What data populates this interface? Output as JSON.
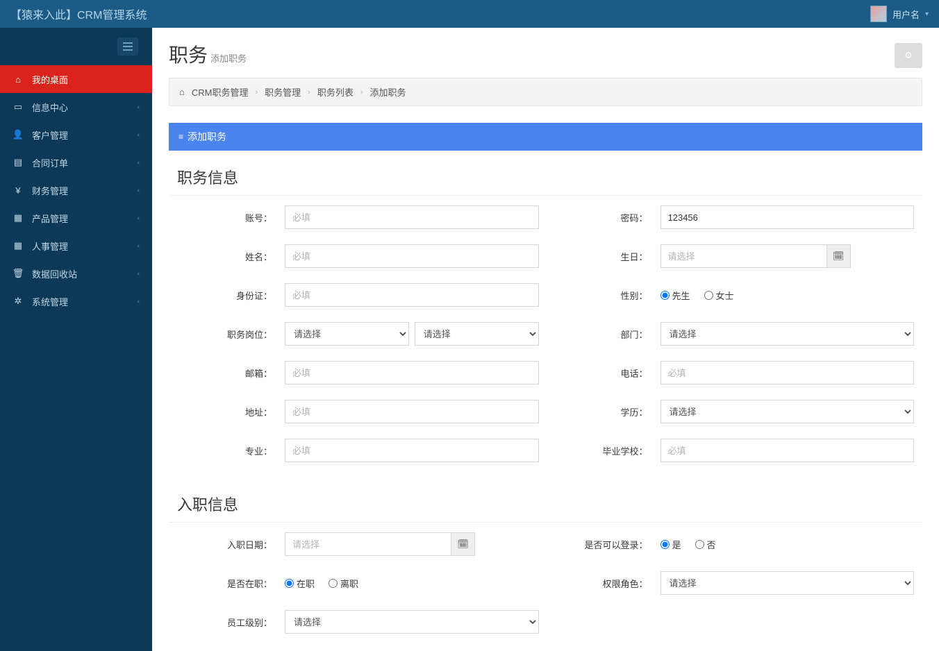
{
  "header": {
    "brand": "【猿来入此】CRM管理系统",
    "username": "用户名"
  },
  "sidebar": {
    "items": [
      {
        "icon": "home",
        "label": "我的桌面",
        "active": true,
        "expandable": false
      },
      {
        "icon": "credit",
        "label": "信息中心",
        "expandable": true
      },
      {
        "icon": "person",
        "label": "客户管理",
        "expandable": true
      },
      {
        "icon": "book",
        "label": "合同订单",
        "expandable": true
      },
      {
        "icon": "yen",
        "label": "财务管理",
        "expandable": true
      },
      {
        "icon": "grid",
        "label": "产品管理",
        "expandable": true
      },
      {
        "icon": "grid",
        "label": "人事管理",
        "expandable": true
      },
      {
        "icon": "trash",
        "label": "数据回收站",
        "expandable": true
      },
      {
        "icon": "cog",
        "label": "系统管理",
        "expandable": true
      }
    ]
  },
  "page": {
    "title": "职务",
    "subtitle": "添加职务"
  },
  "breadcrumb": {
    "items": [
      "CRM职务管理",
      "职务管理",
      "职务列表",
      "添加职务"
    ]
  },
  "panel": {
    "title": "添加职务"
  },
  "sections": {
    "s1_title": "职务信息",
    "s2_title": "入职信息"
  },
  "form": {
    "account": {
      "label": "账号：",
      "placeholder": "必填",
      "value": ""
    },
    "password": {
      "label": "密码：",
      "value": "123456"
    },
    "name": {
      "label": "姓名：",
      "placeholder": "必填",
      "value": ""
    },
    "birthday": {
      "label": "生日：",
      "placeholder": "请选择",
      "value": ""
    },
    "idcard": {
      "label": "身份证：",
      "placeholder": "必填",
      "value": ""
    },
    "gender": {
      "label": "性别：",
      "options": [
        "先生",
        "女士"
      ],
      "selected": "先生"
    },
    "position": {
      "label": "职务岗位：",
      "select1": "请选择",
      "select2": "请选择"
    },
    "department": {
      "label": "部门：",
      "select": "请选择"
    },
    "email": {
      "label": "邮箱：",
      "placeholder": "必填",
      "value": ""
    },
    "phone": {
      "label": "电话：",
      "placeholder": "必填",
      "value": ""
    },
    "address": {
      "label": "地址：",
      "placeholder": "必填",
      "value": ""
    },
    "education": {
      "label": "学历：",
      "select": "请选择"
    },
    "major": {
      "label": "专业：",
      "placeholder": "必填",
      "value": ""
    },
    "school": {
      "label": "毕业学校：",
      "placeholder": "必填",
      "value": ""
    },
    "entry_date": {
      "label": "入职日期：",
      "placeholder": "请选择",
      "value": ""
    },
    "can_login": {
      "label": "是否可以登录：",
      "options": [
        "是",
        "否"
      ],
      "selected": "是"
    },
    "on_job": {
      "label": "是否在职：",
      "options": [
        "在职",
        "离职"
      ],
      "selected": "在职"
    },
    "role": {
      "label": "权限角色：",
      "select": "请选择"
    },
    "level": {
      "label": "员工级别：",
      "select": "请选择"
    }
  }
}
